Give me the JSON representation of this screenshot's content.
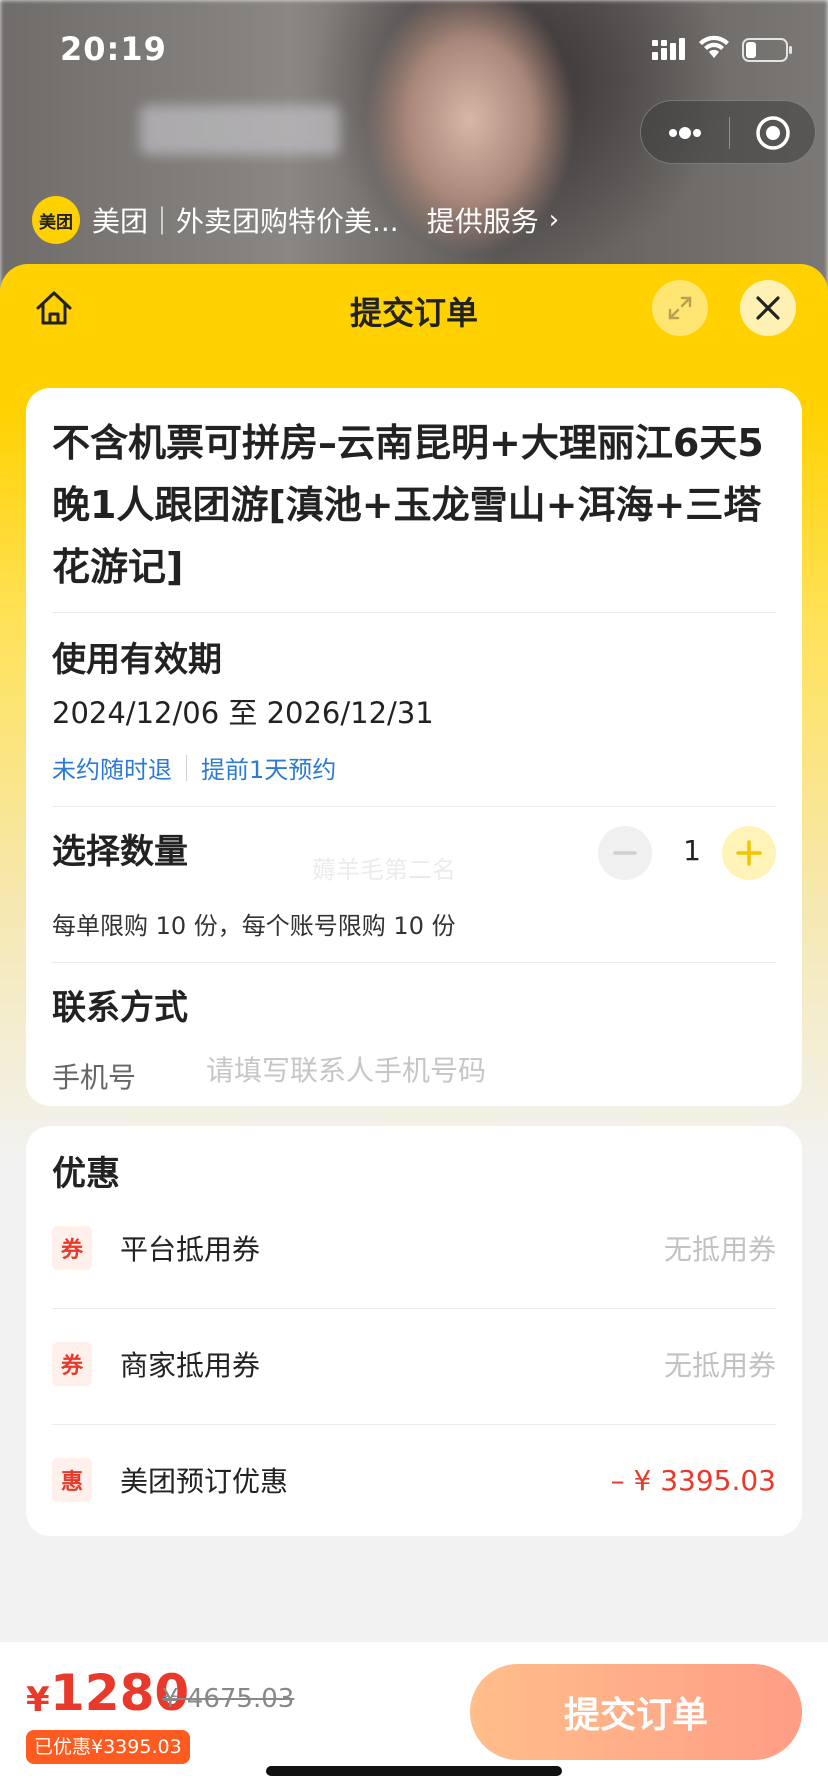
{
  "status_bar": {
    "time": "20:19"
  },
  "provider": {
    "logo_text": "美团",
    "name": "美团｜外卖团购特价美...",
    "service_label": "提供服务",
    "chevron": "›"
  },
  "header": {
    "title": "提交订单"
  },
  "product": {
    "title": "不含机票可拼房–云南昆明+大理丽江6天5晚1人跟团游[滇池+玉龙雪山+洱海+三塔花游记]"
  },
  "validity": {
    "label": "使用有效期",
    "dates": "2024/12/06 至 2026/12/31",
    "tags": [
      "未约随时退",
      "提前1天预约"
    ]
  },
  "quantity": {
    "label": "选择数量",
    "value": "1",
    "limit_text": "每单限购 10 份，每个账号限购 10 份",
    "watermark": "薅羊毛第二名"
  },
  "contact": {
    "label": "联系方式",
    "phone_label": "手机号",
    "phone_placeholder": "请填写联系人手机号码",
    "phone_value": ""
  },
  "discounts": {
    "title": "优惠",
    "items": [
      {
        "badge": "券",
        "label": "平台抵用券",
        "value": "无抵用券"
      },
      {
        "badge": "券",
        "label": "商家抵用券",
        "value": "无抵用券"
      },
      {
        "badge": "惠",
        "label": "美团预订优惠",
        "value": "– ¥ 3395.03"
      }
    ]
  },
  "bottom": {
    "currency": "¥",
    "price": "1280",
    "original_price": "¥ 4675.03",
    "saved_text": "已优惠¥3395.03",
    "submit_label": "提交订单"
  },
  "colors": {
    "brand_yellow": "#ffd100",
    "price_red": "#e8392b",
    "link_blue": "#2c7ad6",
    "submit_gradient_start": "#ffbe8a",
    "submit_gradient_end": "#ff9d86"
  },
  "icons": [
    "signal-icon",
    "wifi-icon",
    "battery-icon",
    "more-icon",
    "target-icon",
    "home-icon",
    "expand-icon",
    "close-icon",
    "minus-icon",
    "plus-icon"
  ]
}
